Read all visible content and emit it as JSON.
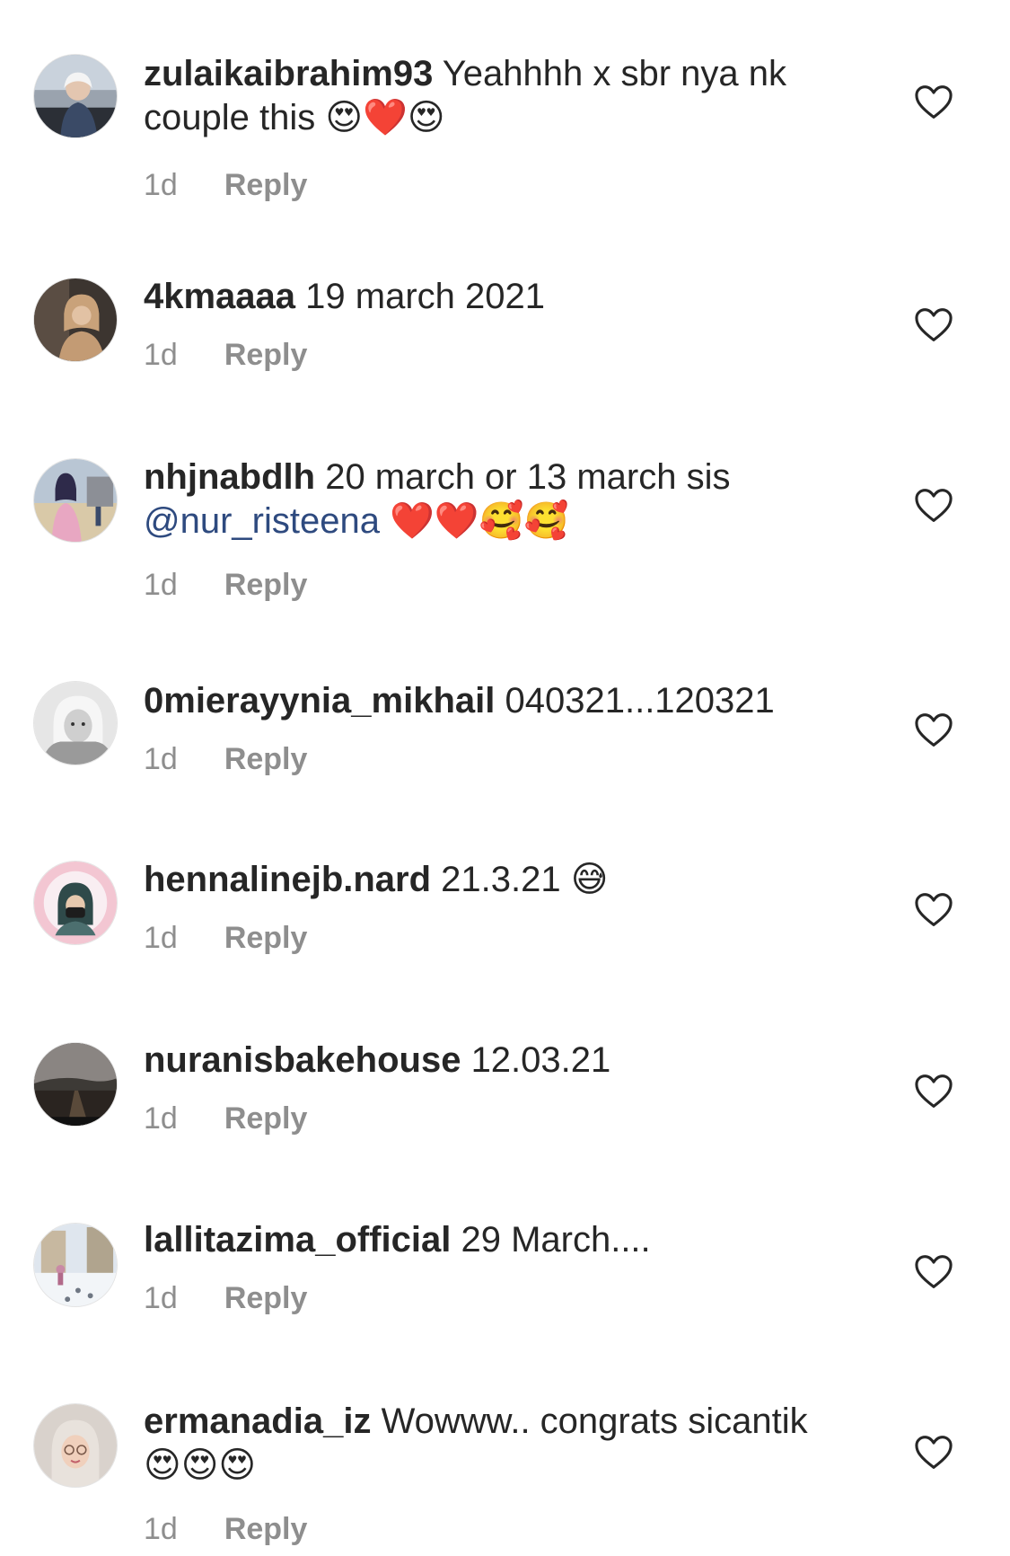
{
  "colors": {
    "text": "#262626",
    "muted": "#8e8e8e",
    "mention": "#2e4a7f",
    "heart_outline": "#262626"
  },
  "comments": [
    {
      "username": "zulaikaibrahim93",
      "text": "Yeahhhh x sbr nya nk couple this",
      "emojis": "😍❤️😍",
      "mention": "",
      "time": "1d",
      "reply_label": "Reply",
      "avatar_icon": "avatar-photo-car"
    },
    {
      "username": "4kmaaaa",
      "text": "19 march 2021",
      "emojis": "",
      "mention": "",
      "time": "1d",
      "reply_label": "Reply",
      "avatar_icon": "avatar-photo-hijab"
    },
    {
      "username": "nhjnabdlh",
      "text": "20 march or 13 march sis",
      "emojis": "❤️❤️🥰🥰",
      "mention": "@nur_risteena",
      "time": "1d",
      "reply_label": "Reply",
      "avatar_icon": "avatar-photo-outdoor"
    },
    {
      "username": "0mierayynia_mikhail",
      "text": "040321...120321",
      "emojis": "",
      "mention": "",
      "time": "1d",
      "reply_label": "Reply",
      "avatar_icon": "avatar-photo-bw"
    },
    {
      "username": "hennalinejb.nard",
      "text": "21.3.21",
      "emojis": "😅",
      "mention": "",
      "time": "1d",
      "reply_label": "Reply",
      "avatar_icon": "avatar-photo-pink-frame"
    },
    {
      "username": "nuranisbakehouse",
      "text": "12.03.21",
      "emojis": "",
      "mention": "",
      "time": "1d",
      "reply_label": "Reply",
      "avatar_icon": "avatar-photo-road"
    },
    {
      "username": "lallitazima_official",
      "text": "29 March....",
      "emojis": "",
      "mention": "",
      "time": "1d",
      "reply_label": "Reply",
      "avatar_icon": "avatar-photo-snow"
    },
    {
      "username": "ermanadia_iz",
      "text": "Wowww.. congrats sicantik",
      "emojis": "😍😍😍",
      "mention": "",
      "time": "1d",
      "reply_label": "Reply",
      "avatar_icon": "avatar-photo-glasses"
    }
  ]
}
